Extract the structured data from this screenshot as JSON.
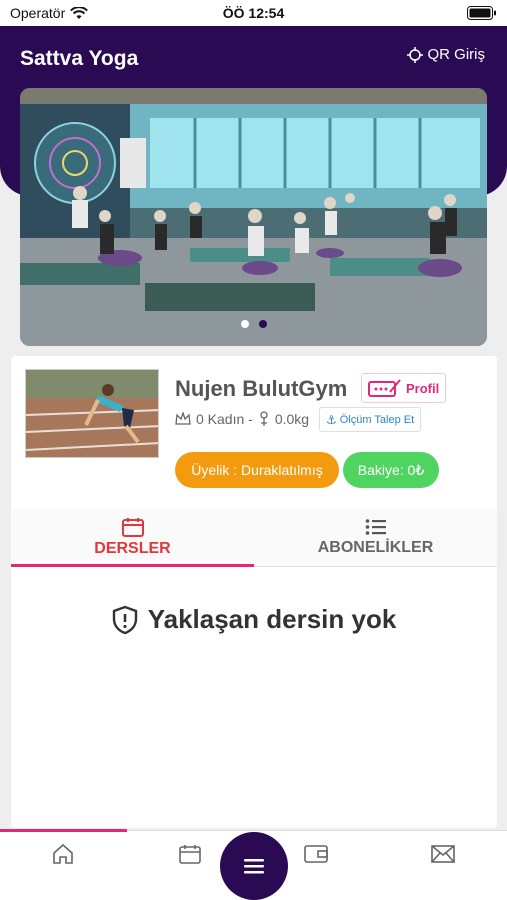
{
  "status_bar": {
    "carrier": "Operatör",
    "time": "ÖÖ 12:54"
  },
  "header": {
    "title": "Sattva Yoga",
    "qr_label": "QR Giriş"
  },
  "banner": {
    "slide_count": 2,
    "active_slide": 2
  },
  "profile": {
    "name": "Nujen BulutGym",
    "profil_label": "Profil",
    "stats": "0 Kadın - ",
    "weight": "0.0kg",
    "olcum_label": "Ölçüm Talep Et",
    "membership": "Üyelik : Duraklatılmış",
    "balance": "Bakiye: 0₺"
  },
  "tabs": [
    {
      "label": "DERSLER",
      "icon": "calendar-icon",
      "active": true
    },
    {
      "label": "ABONELİKLER",
      "icon": "list-icon",
      "active": false
    }
  ],
  "empty_state": {
    "message": "Yaklaşan dersin yok",
    "icon": "shield-alert-icon"
  },
  "bottom_nav": {
    "items": [
      "home-icon",
      "calendar-icon",
      "menu-icon",
      "wallet-icon",
      "mail-icon"
    ],
    "active": "home-icon"
  },
  "colors": {
    "primary": "#2a0a52",
    "accent": "#e22877",
    "orange": "#f39a0e",
    "green": "#4fd460",
    "active_tab": "#e3373c"
  }
}
